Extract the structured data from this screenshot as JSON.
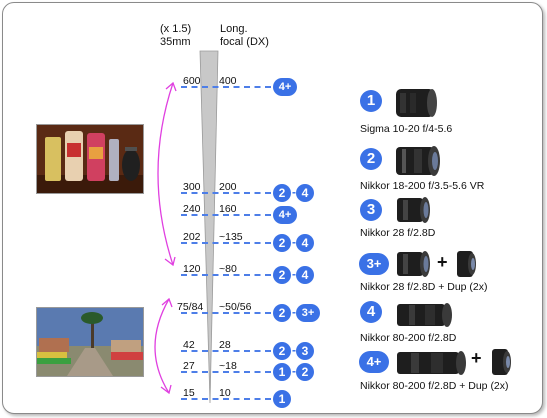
{
  "header": {
    "crop_factor": "(x 1.5)",
    "mm_35": "35mm",
    "long_focal": "Long.",
    "focal_dx": "focal (DX)"
  },
  "rows": [
    {
      "mm35": "600",
      "dx": "400",
      "badges": [
        "4+"
      ]
    },
    {
      "mm35": "300",
      "dx": "200",
      "badges": [
        "2",
        "4"
      ]
    },
    {
      "mm35": "240",
      "dx": "160",
      "badges": [
        "4+"
      ]
    },
    {
      "mm35": "202",
      "dx": "~135",
      "badges": [
        "2",
        "4"
      ]
    },
    {
      "mm35": "120",
      "dx": "~80",
      "badges": [
        "2",
        "4"
      ]
    },
    {
      "mm35": "75/84",
      "dx": "~50/56",
      "badges": [
        "2",
        "3+"
      ]
    },
    {
      "mm35": "42",
      "dx": "28",
      "badges": [
        "2",
        "3"
      ]
    },
    {
      "mm35": "27",
      "dx": "~18",
      "badges": [
        "1",
        "2"
      ]
    },
    {
      "mm35": "15",
      "dx": "10",
      "badges": [
        "1"
      ]
    }
  ],
  "lenses": [
    {
      "badge": "1",
      "name": "Sigma 10-20 f/4-5.6",
      "icon": "wide-zoom-lens-icon"
    },
    {
      "badge": "2",
      "name": "Nikkor 18-200 f/3.5-5.6 VR",
      "icon": "zoom-lens-icon"
    },
    {
      "badge": "3",
      "name": "Nikkor 28 f/2.8D",
      "icon": "prime-lens-icon"
    },
    {
      "badge": "3+",
      "name": "Nikkor 28 f/2.8D + Dup (2x)",
      "icon": "prime-lens-teleconverter-icon"
    },
    {
      "badge": "4",
      "name": "Nikkor 80-200 f/2.8D",
      "icon": "telephoto-lens-icon"
    },
    {
      "badge": "4+",
      "name": "Nikkor 80-200 f/2.8D + Dup (2x)",
      "icon": "telephoto-lens-teleconverter-icon"
    }
  ],
  "plus_sign": "+",
  "colors": {
    "badge": "#3a71e6",
    "guide": "#4d7ee8",
    "arrow": "#e040e0",
    "cone": "#c8c8c8"
  }
}
